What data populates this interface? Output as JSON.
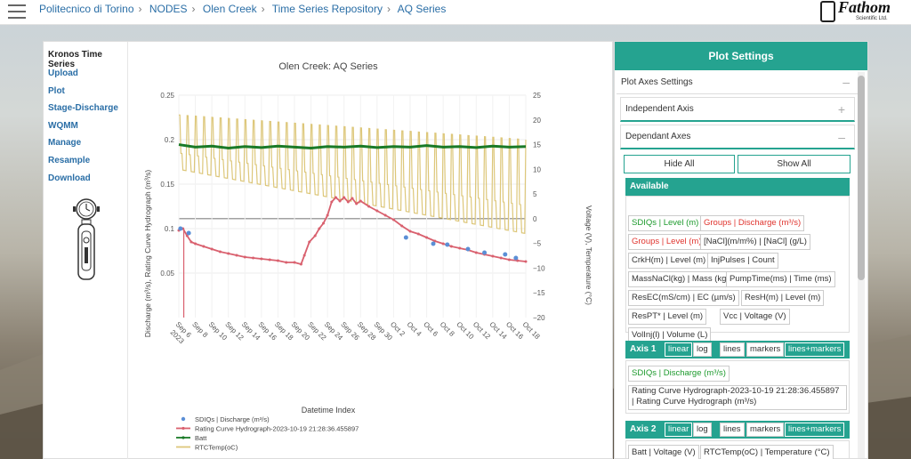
{
  "breadcrumb": [
    "Politecnico di Torino",
    "NODES",
    "Olen Creek",
    "Time Series Repository",
    "AQ Series"
  ],
  "logo": {
    "name": "Fathom",
    "sub": "Scientific Ltd."
  },
  "sidebar": {
    "title": "Kronos Time Series",
    "items": [
      "Upload",
      "Plot",
      "Stage-Discharge",
      "WQMM",
      "Manage",
      "Resample",
      "Download"
    ]
  },
  "chart_data": {
    "type": "line",
    "title": "Olen Creek: AQ Series",
    "xlabel": "Datetime Index",
    "ylabel_left": "Discharge (m³/s), Rating Curve Hydrograph (m³/s)",
    "ylabel_right": "Voltage (V), Temperature (°C)",
    "x_ticks": [
      "Sep 6\n2023",
      "Sep 8",
      "Sep 10",
      "Sep 12",
      "Sep 14",
      "Sep 16",
      "Sep 18",
      "Sep 20",
      "Sep 22",
      "Sep 24",
      "Sep 26",
      "Sep 28",
      "Sep 30",
      "Oct 2",
      "Oct 4",
      "Oct 6",
      "Oct 8",
      "Oct 10",
      "Oct 12",
      "Oct 14",
      "Oct 16",
      "Oct 18"
    ],
    "y_left_ticks": [
      "0.05",
      "0.1",
      "0.15",
      "0.2",
      "0.25"
    ],
    "y_left_range": [
      0,
      0.25
    ],
    "y_right_ticks": [
      "−20",
      "−15",
      "−10",
      "−5",
      "0",
      "5",
      "10",
      "15",
      "20",
      "25"
    ],
    "y_right_range": [
      -20,
      25
    ],
    "series": [
      {
        "name": "SDIQs | Discharge (m³/s)",
        "color": "#5b8fd6",
        "style": "markers",
        "points": [
          [
            0.2,
            0.1
          ],
          [
            1.2,
            0.095
          ],
          [
            27.5,
            0.09
          ],
          [
            30.8,
            0.083
          ],
          [
            32.5,
            0.082
          ],
          [
            35,
            0.077
          ],
          [
            37,
            0.073
          ],
          [
            39.5,
            0.071
          ],
          [
            40.8,
            0.067
          ]
        ]
      },
      {
        "name": "Rating Curve Hydrograph-2023-10-19 21:28:36.455897",
        "color": "#d9606e",
        "style": "lines+markers",
        "points": [
          [
            0,
            0.098
          ],
          [
            0.5,
            0.1
          ],
          [
            1,
            0.092
          ],
          [
            1.5,
            0.085
          ],
          [
            2,
            0.083
          ],
          [
            3,
            0.08
          ],
          [
            4,
            0.077
          ],
          [
            5,
            0.074
          ],
          [
            6,
            0.072
          ],
          [
            7,
            0.07
          ],
          [
            8,
            0.068
          ],
          [
            9,
            0.067
          ],
          [
            10,
            0.066
          ],
          [
            11,
            0.065
          ],
          [
            12,
            0.064
          ],
          [
            13,
            0.062
          ],
          [
            14,
            0.062
          ],
          [
            14.8,
            0.06
          ],
          [
            15.2,
            0.07
          ],
          [
            15.8,
            0.085
          ],
          [
            16.5,
            0.092
          ],
          [
            17,
            0.1
          ],
          [
            17.5,
            0.106
          ],
          [
            18,
            0.115
          ],
          [
            18.5,
            0.13
          ],
          [
            19,
            0.135
          ],
          [
            19.5,
            0.131
          ],
          [
            20,
            0.135
          ],
          [
            20.5,
            0.13
          ],
          [
            21,
            0.134
          ],
          [
            21.5,
            0.128
          ],
          [
            22,
            0.131
          ],
          [
            23,
            0.125
          ],
          [
            24,
            0.12
          ],
          [
            25,
            0.115
          ],
          [
            26,
            0.11
          ],
          [
            27,
            0.103
          ],
          [
            28,
            0.097
          ],
          [
            29,
            0.094
          ],
          [
            30,
            0.09
          ],
          [
            31,
            0.086
          ],
          [
            32,
            0.083
          ],
          [
            33,
            0.08
          ],
          [
            34,
            0.078
          ],
          [
            35,
            0.076
          ],
          [
            36,
            0.073
          ],
          [
            37,
            0.071
          ],
          [
            38,
            0.069
          ],
          [
            39,
            0.067
          ],
          [
            40,
            0.065
          ],
          [
            41,
            0.064
          ],
          [
            42,
            0.063
          ]
        ]
      },
      {
        "name": "Batt",
        "color": "#1a7a27",
        "style": "lines+markers",
        "axis": "right",
        "points": [
          [
            0,
            15
          ],
          [
            2,
            14.5
          ],
          [
            4,
            14.7
          ],
          [
            6,
            14.3
          ],
          [
            8,
            14.6
          ],
          [
            10,
            14.4
          ],
          [
            12,
            14.7
          ],
          [
            14,
            14.5
          ],
          [
            16,
            14.3
          ],
          [
            18,
            14.6
          ],
          [
            20,
            14.5
          ],
          [
            22,
            14.7
          ],
          [
            24,
            14.4
          ],
          [
            26,
            14.6
          ],
          [
            28,
            14.5
          ],
          [
            30,
            14.8
          ],
          [
            32,
            14.5
          ],
          [
            34,
            14.6
          ],
          [
            36,
            14.4
          ],
          [
            38,
            14.7
          ],
          [
            40,
            14.5
          ],
          [
            42,
            14.6
          ]
        ]
      },
      {
        "name": "RTCTemp(oC)",
        "color": "#ddc77a",
        "style": "lines",
        "axis": "right",
        "period_days": 1,
        "min_start": 10,
        "max_start": 21,
        "min_end": -3,
        "max_end": 16
      }
    ],
    "legend_position": "bottom",
    "reference_line": {
      "axis": "right",
      "y": 0
    }
  },
  "settings": {
    "title": "Plot Settings",
    "plot_axes": "Plot Axes Settings",
    "independent": "Independent Axis",
    "dependant": "Dependant Axes",
    "hide_all": "Hide All",
    "show_all": "Show All",
    "available": "Available",
    "chips": [
      {
        "label": "SDIQs | Level (m)",
        "c": "g"
      },
      {
        "label": "Groups | Discharge (m³/s)",
        "c": "r"
      },
      {
        "label": "Groups | Level (m)",
        "c": "r"
      },
      {
        "label": "[NaCl](m/m%) | [NaCl] (g/L)",
        "c": ""
      },
      {
        "label": "CrkH(m) | Level (m)",
        "c": ""
      },
      {
        "label": "InjPulses | Count",
        "c": ""
      },
      {
        "label": "MassNaCl(kg) | Mass (kg)",
        "c": ""
      },
      {
        "label": "PumpTime(ms) | Time (ms)",
        "c": ""
      },
      {
        "label": "ResEC(mS/cm) | EC (µm/s)",
        "c": ""
      },
      {
        "label": "ResH(m) | Level (m)",
        "c": ""
      },
      {
        "label": "ResPT* | Level (m)",
        "c": ""
      },
      {
        "label": "Vcc | Voltage (V)",
        "c": ""
      },
      {
        "label": "VolInj(l) | Volume (L)",
        "c": ""
      }
    ],
    "axis1": {
      "label": "Axis 1",
      "modes": [
        "linear",
        "log"
      ],
      "styles": [
        "lines",
        "markers",
        "lines+markers"
      ],
      "items": [
        "SDIQs | Discharge (m³/s)",
        "Rating Curve Hydrograph-2023-10-19 21:28:36.455897 | Rating Curve Hydrograph (m³/s)"
      ]
    },
    "axis2": {
      "label": "Axis 2",
      "modes": [
        "linear",
        "log"
      ],
      "styles": [
        "lines",
        "markers",
        "lines+markers"
      ],
      "items": [
        "Batt | Voltage (V)",
        "RTCTemp(oC) | Temperature (°C)"
      ]
    }
  }
}
